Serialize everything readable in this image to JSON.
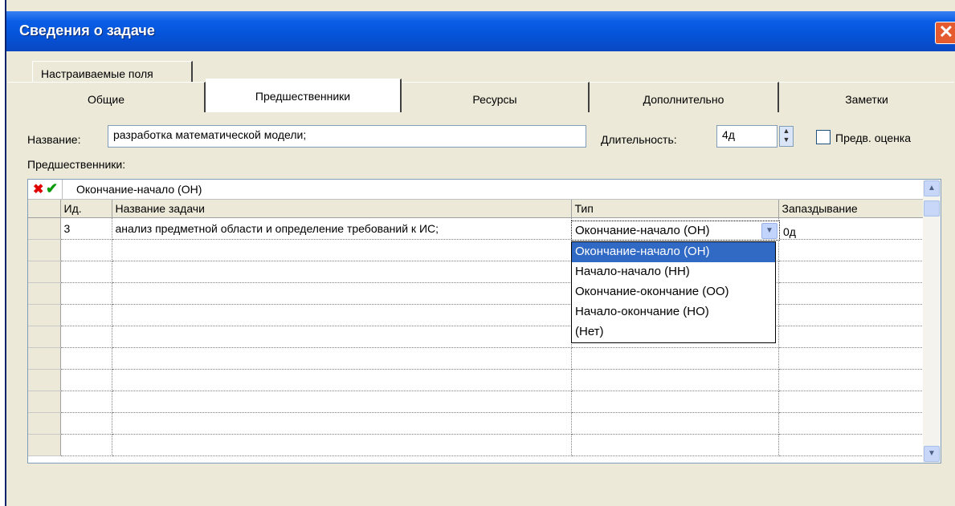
{
  "dialog": {
    "title": "Сведения о задаче",
    "close_glyph": "✕"
  },
  "tabs": {
    "row2": [
      "Настраиваемые поля"
    ],
    "row1": [
      "Общие",
      "Предшественники",
      "Ресурсы",
      "Дополнительно",
      "Заметки"
    ],
    "active": "Предшественники"
  },
  "form": {
    "name_label": "Название:",
    "name_value": "разработка математической модели;",
    "duration_label": "Длительность:",
    "duration_value": "4д",
    "estimate_label": "Предв. оценка",
    "predecessors_label": "Предшественники:"
  },
  "grid": {
    "entry_value": "Окончание-начало (ОН)",
    "columns": [
      "Ид.",
      "Название задачи",
      "Тип",
      "Запаздывание"
    ],
    "rows": [
      {
        "id": "3",
        "name": "анализ предметной области и определение требований к ИС;",
        "type": "Окончание-начало (ОН)",
        "lag": "0д"
      }
    ],
    "empty_rows": 10
  },
  "type_dropdown": {
    "current": "Окончание-начало (ОН)",
    "options": [
      "Окончание-начало (ОН)",
      "Начало-начало (НН)",
      "Окончание-окончание (ОО)",
      "Начало-окончание (НО)",
      "(Нет)"
    ],
    "selected_index": 0
  },
  "icons": {
    "cancel": "cancel-x-icon",
    "accept": "accept-check-icon",
    "dropdown": "chevron-down-icon"
  },
  "colors": {
    "title_bar": "#0553d8",
    "selection": "#316AC5",
    "cancel": "#e00000",
    "accept": "#0a9a0a"
  }
}
